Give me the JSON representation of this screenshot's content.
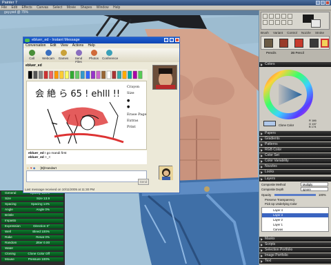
{
  "app": {
    "title": "Painter 7"
  },
  "menubar": {
    "items": [
      "File",
      "Edit",
      "Effects",
      "Canvas",
      "Select",
      "Movie",
      "Shapes",
      "Window",
      "Help"
    ]
  },
  "document": {
    "title": "guy.psd @ 75%"
  },
  "messenger": {
    "title": "ebluer_ed - Instant Message",
    "menu": [
      "Conversation",
      "Edit",
      "View",
      "Actions",
      "Help"
    ],
    "toolbar": [
      "Call",
      "Webcam",
      "Games",
      "Send Files",
      "Photos",
      "Conference"
    ],
    "to_label": "ebluer_ed",
    "sketch_text": "会 絶 ら 65 ! ehlll !!",
    "side_labels": [
      "Crayon Size",
      "Erase Page",
      "Extras",
      "Print"
    ],
    "messages": [
      {
        "sender": "ebluer_ed",
        "text": "I go mandi first"
      },
      {
        "sender": "ebluer_ed",
        "text": ">_<"
      }
    ],
    "ink_label": "[B]/Handwrt",
    "send_label": "Send",
    "status": "Last message received on 10/11/2005 at 11:30 PM"
  },
  "left_panel": {
    "rows": [
      {
        "label": "General",
        "value": "Opacity 100%"
      },
      {
        "label": "Size",
        "value": "Size 13.9"
      },
      {
        "label": "Spacing",
        "value": "Spacing 14%"
      },
      {
        "label": "Angle",
        "value": "Angle 0%"
      },
      {
        "label": "Bristle",
        "value": ""
      },
      {
        "label": "Impasto",
        "value": ""
      },
      {
        "label": "Expression",
        "value": "Direction 0°"
      },
      {
        "label": "Well",
        "value": "Bleed 100%"
      },
      {
        "label": "Rake",
        "value": "Resat 0%"
      },
      {
        "label": "Random",
        "value": "Jitter 0.00"
      },
      {
        "label": "Water",
        "value": ""
      },
      {
        "label": "Cloning",
        "value": "Clone Color Off"
      },
      {
        "label": "Mouse",
        "value": "Pressure 100%"
      }
    ]
  },
  "right_panel": {
    "brush_tabs": [
      "Brush",
      "Variant",
      "Control",
      "Nozzle",
      "Stroke"
    ],
    "brush_row": [
      "Pencils",
      "2B Pencil"
    ],
    "colors_title": "Colors",
    "clone_color": "Clone Color",
    "rgb": [
      "R 186",
      "G 157",
      "B 174"
    ],
    "palettes": [
      "Papers",
      "Gradients",
      "Patterns",
      "RGB Color",
      "Color Set",
      "Color Variability",
      "Nozzles",
      "Looks"
    ],
    "layers_title": "Layers",
    "composite_method_label": "Composite Method",
    "composite_method_value": "Multiply",
    "composite_depth_label": "Composite Depth",
    "composite_depth_value": "Ignore",
    "opacity_label": "Opacity",
    "opacity_value": "100%",
    "preserve": "Preserve Transparency",
    "pickup": "Pick Up Underlying Color",
    "layers": [
      "Layer 4",
      "Layer 3",
      "Layer 2",
      "Layer 1",
      "Canvas"
    ],
    "bottom_palettes": [
      "Masks",
      "Scripts",
      "Selection Portfolio",
      "Image Portfolio",
      "Text"
    ]
  },
  "accent": "#0d7a2c"
}
